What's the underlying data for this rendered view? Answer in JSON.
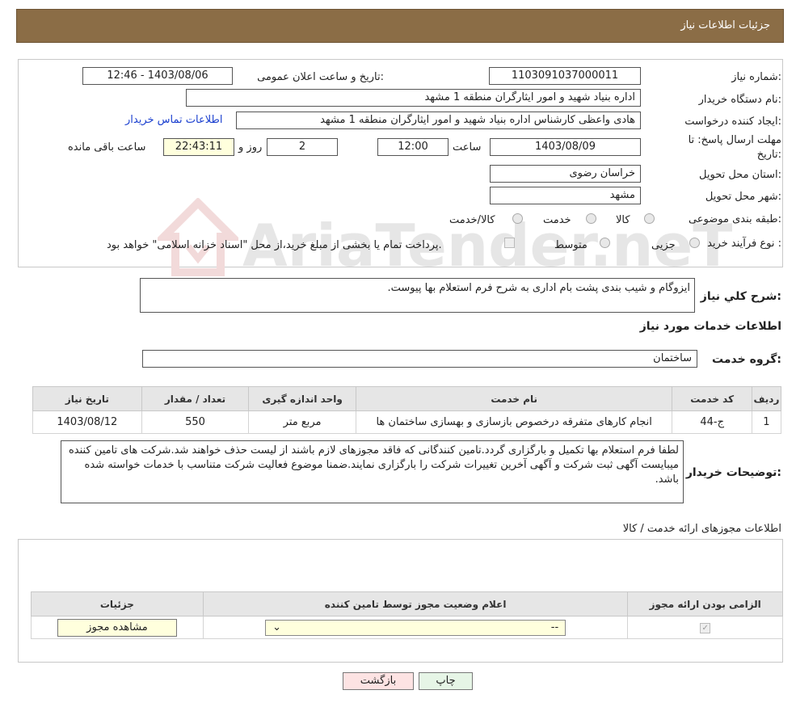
{
  "header": {
    "title": "جزئیات اطلاعات نیاز"
  },
  "form": {
    "need_number_label": "شماره نیاز:",
    "need_number": "1103091037000011",
    "announce_label": "تاریخ و ساعت اعلان عمومی:",
    "announce_value": "1403/08/06 - 12:46",
    "buyer_org_label": "نام دستگاه خریدار:",
    "buyer_org": "اداره بنیاد شهید و امور ایثارگران منطقه 1 مشهد",
    "creator_label": "ایجاد کننده درخواست:",
    "creator": "هادی واعظی کارشناس اداره بنیاد شهید و امور ایثارگران منطقه 1 مشهد",
    "contact_link": "اطلاعات تماس خریدار",
    "deadline_label_1": "مهلت ارسال پاسخ: تا",
    "deadline_label_2": "تاریخ:",
    "deadline_date": "1403/08/09",
    "time_label": "ساعت",
    "deadline_time": "12:00",
    "days_value": "2",
    "days_label": "روز و",
    "remaining_time": "22:43:11",
    "remaining_label": "ساعت باقی مانده",
    "province_label": "استان محل تحویل:",
    "province": "خراسان رضوی",
    "city_label": "شهر محل تحویل:",
    "city": "مشهد",
    "category_label": "طبقه بندی موضوعی:",
    "category_options": [
      "کالا",
      "خدمت",
      "کالا/خدمت"
    ],
    "purchase_type_label": "نوع فرآیند خرید :",
    "purchase_options": [
      "جزیی",
      "متوسط"
    ],
    "purchase_note": "پرداخت تمام یا بخشی از مبلغ خرید،از محل \"اسناد خزانه اسلامی\" خواهد بود."
  },
  "summary": {
    "label": "شرح کلي نياز:",
    "text": "ایزوگام و شیب بندی پشت بام اداری به شرح فرم استعلام بها پیوست."
  },
  "services": {
    "section_title": "اطلاعات خدمات مورد نیاز",
    "group_label": "گروه خدمت:",
    "group_value": "ساختمان",
    "columns": [
      "ردیف",
      "کد خدمت",
      "نام خدمت",
      "واحد اندازه گیری",
      "تعداد / مقدار",
      "تاریخ نیاز"
    ],
    "rows": [
      [
        "1",
        "ج-44",
        "انجام کارهای متفرقه درخصوص بازسازی و بهسازی ساختمان ها",
        "مربع متر",
        "550",
        "1403/08/12"
      ]
    ]
  },
  "buyer_notes": {
    "label": "توضیحات خریدار:",
    "text": "لطفا فرم استعلام بها تکمیل و بارگزاری گردد.تامین کنندگانی که فاقد مجوزهای لازم باشند از لیست حذف خواهند شد.شرکت های تامین کننده میبایست آگهی ثبت شرکت و آگهی آخرین تغییرات شرکت را بارگزاری نمایند.ضمنا موضوع فعالیت شرکت متناسب با خدمات خواسته شده باشد."
  },
  "permits": {
    "section_title": "اطلاعات مجوزهای ارائه خدمت / کالا",
    "columns": [
      "الزامی بودن ارائه مجوز",
      "اعلام وضعیت مجوز توسط تامین کننده",
      "جزئیات"
    ],
    "select_value": "--",
    "view_button": "مشاهده مجوز"
  },
  "buttons": {
    "print": "چاپ",
    "back": "بازگشت"
  },
  "watermark": {
    "text": "AriaTender.neT"
  }
}
